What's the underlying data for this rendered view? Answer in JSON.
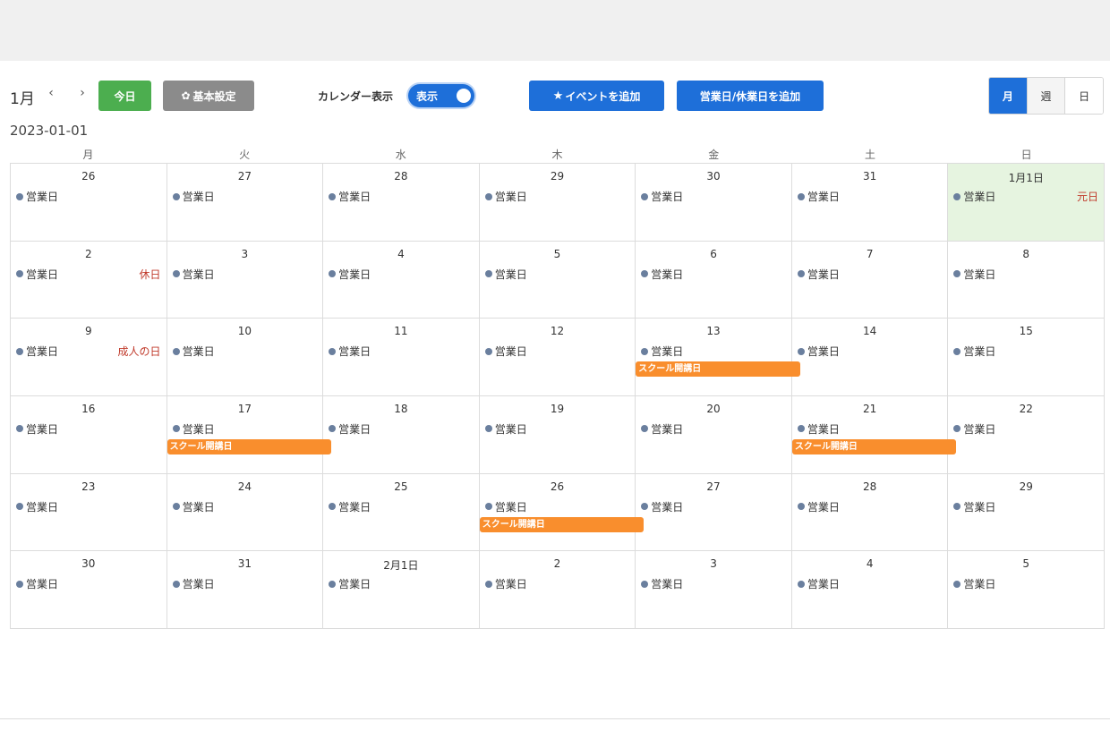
{
  "toolbar": {
    "month": "1月",
    "prev_icon": "‹",
    "next_icon": "›",
    "today_label": "今日",
    "settings_label": "基本設定",
    "calendar_display_label": "カレンダー表示",
    "toggle_label": "表示",
    "toggle_on": true,
    "add_event_label": "イベントを追加",
    "add_bizday_label": "営業日/休業日を追加",
    "views": [
      "月",
      "週",
      "日"
    ],
    "active_view": "月"
  },
  "current_date": "2023-01-01",
  "weekdays": [
    "月",
    "火",
    "水",
    "木",
    "金",
    "土",
    "日"
  ],
  "biz_label": "営業日",
  "colors": {
    "today_button": "#4cae4f",
    "primary": "#1e6fd9",
    "settings_button": "#8b8b8b",
    "event": "#f98e2d",
    "holiday_text": "#c03a2b",
    "today_cell": "#e6f4e0"
  },
  "weeks": [
    [
      {
        "day": "26"
      },
      {
        "day": "27"
      },
      {
        "day": "28"
      },
      {
        "day": "29"
      },
      {
        "day": "30"
      },
      {
        "day": "31"
      },
      {
        "day": "1月1日",
        "holiday": "元日",
        "today": true
      }
    ],
    [
      {
        "day": "2",
        "holiday": "休日"
      },
      {
        "day": "3"
      },
      {
        "day": "4"
      },
      {
        "day": "5"
      },
      {
        "day": "6"
      },
      {
        "day": "7"
      },
      {
        "day": "8"
      }
    ],
    [
      {
        "day": "9",
        "holiday": "成人の日"
      },
      {
        "day": "10"
      },
      {
        "day": "11"
      },
      {
        "day": "12"
      },
      {
        "day": "13",
        "event": "スクール開講日"
      },
      {
        "day": "14"
      },
      {
        "day": "15"
      }
    ],
    [
      {
        "day": "16"
      },
      {
        "day": "17",
        "event": "スクール開講日"
      },
      {
        "day": "18"
      },
      {
        "day": "19"
      },
      {
        "day": "20"
      },
      {
        "day": "21",
        "event": "スクール開講日"
      },
      {
        "day": "22"
      }
    ],
    [
      {
        "day": "23"
      },
      {
        "day": "24"
      },
      {
        "day": "25"
      },
      {
        "day": "26",
        "event": "スクール開講日"
      },
      {
        "day": "27"
      },
      {
        "day": "28"
      },
      {
        "day": "29"
      }
    ],
    [
      {
        "day": "30"
      },
      {
        "day": "31"
      },
      {
        "day": "2月1日"
      },
      {
        "day": "2"
      },
      {
        "day": "3"
      },
      {
        "day": "4"
      },
      {
        "day": "5"
      }
    ]
  ]
}
